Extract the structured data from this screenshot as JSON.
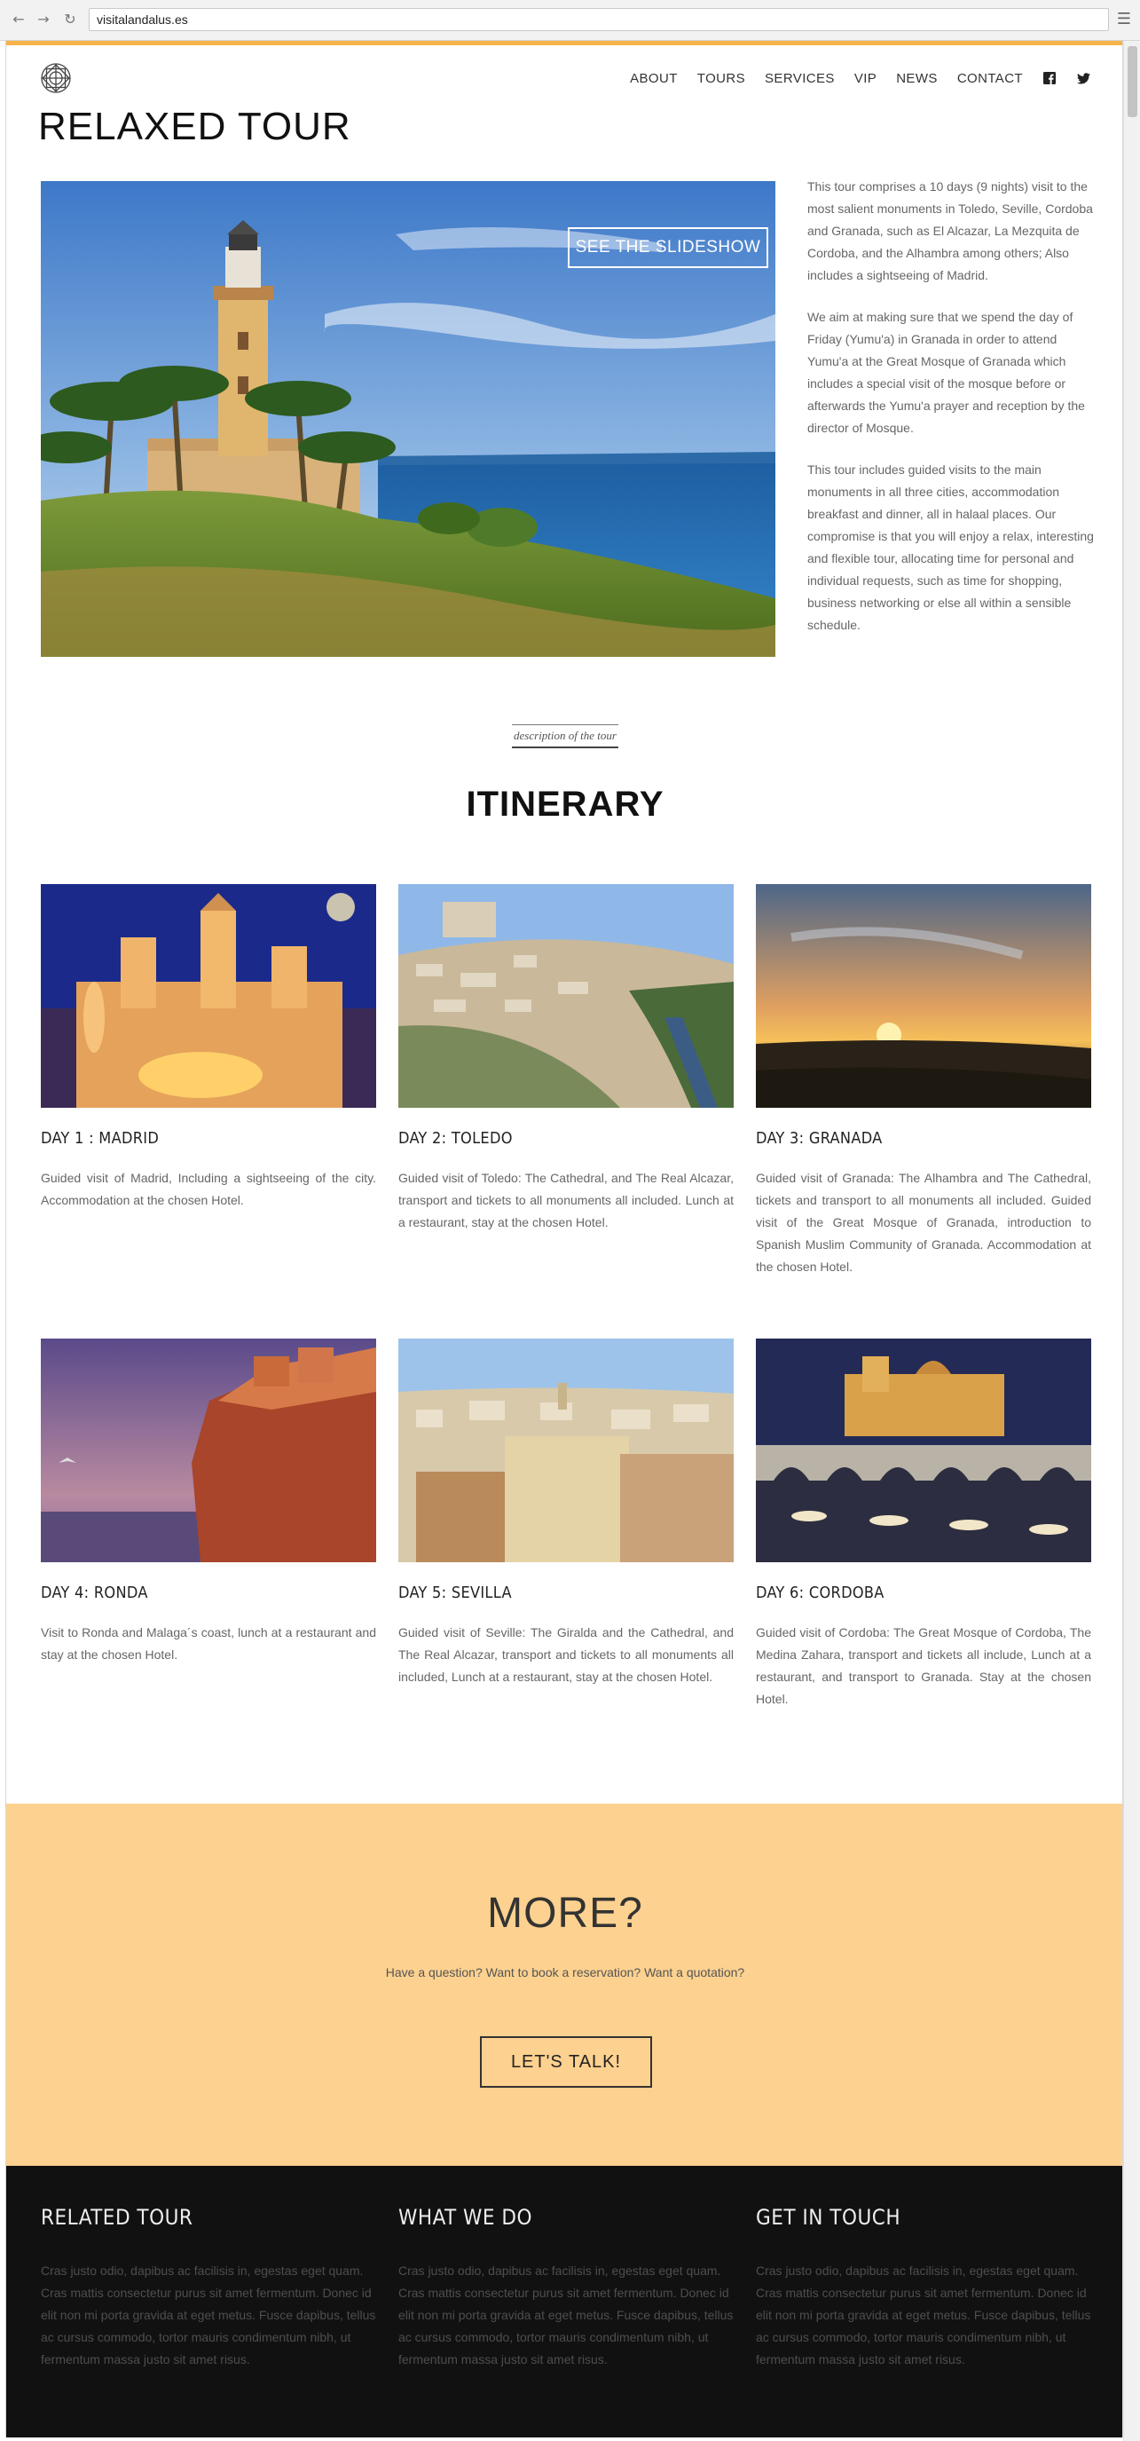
{
  "browser": {
    "url": "visitalandalus.es",
    "back_icon": "arrow-left-icon",
    "forward_icon": "arrow-right-icon",
    "reload_icon": "reload-icon",
    "menu_icon": "hamburger-menu-icon"
  },
  "colors": {
    "accent": "#f7b24a",
    "more_bg": "#fdd18f",
    "footer_bg": "#111111"
  },
  "header": {
    "logo_icon": "geometric-star-logo-icon",
    "nav": [
      "ABOUT",
      "TOURS",
      "SERVICES",
      "VIP",
      "NEWS",
      "CONTACT"
    ],
    "social_icons": [
      "facebook-icon",
      "twitter-icon"
    ]
  },
  "page": {
    "title": "RELAXED TOUR",
    "slideshow_label": "SEE THE SLIDESHOW",
    "intro": [
      "This tour comprises a 10 days (9 nights) visit to the most salient monuments in Toledo, Seville, Cordoba and Granada, such as El Alcazar, La Mezquita de Cordoba, and the Alhambra among others; Also includes a sightseeing of Madrid.",
      "We aim at making sure that we spend the day of Friday (Yumu'a) in Granada in order to attend Yumu'a at the Great Mosque of Granada which includes a special visit of the mosque before or afterwards the Yumu'a prayer and reception by the director of Mosque.",
      "This tour includes guided visits to the main monuments in all three cities, accommodation breakfast and dinner, all in halaal places. Our compromise is that you will enjoy a relax, interesting and flexible tour, allocating time for personal and individual requests, such as time for shopping, business networking or else all within a sensible schedule."
    ]
  },
  "itinerary": {
    "kicker": "description of the tour",
    "title": "ITINERARY",
    "days": [
      {
        "title": "DAY 1 : MADRID",
        "text": "Guided visit of Madrid, Including a sightseeing of the city. Accommodation at the chosen Hotel."
      },
      {
        "title": "DAY 2: TOLEDO",
        "text": "Guided visit of Toledo: The Cathedral, and The Real Alcazar, transport and tickets to all monuments all included. Lunch at a restaurant, stay at the chosen Hotel."
      },
      {
        "title": "DAY 3: GRANADA",
        "text": "Guided visit of Granada: The Alhambra and The Cathedral, tickets and transport to all monuments all included. Guided visit of the Great Mosque of Granada, introduction to Spanish Muslim Community of Granada. Accommodation at the chosen Hotel."
      },
      {
        "title": "DAY 4: RONDA",
        "text": "Visit to Ronda and Malaga´s coast, lunch at a restaurant and stay at the chosen Hotel."
      },
      {
        "title": "DAY 5: SEVILLA",
        "text": "Guided visit of Seville: The Giralda and the Cathedral, and The Real Alcazar, transport and tickets to all monuments all included, Lunch at a restaurant, stay at the chosen Hotel."
      },
      {
        "title": "DAY 6: CORDOBA",
        "text": "Guided visit of Cordoba: The Great Mosque of Cordoba, The Medina Zahara, transport and tickets all include, Lunch at a restaurant, and transport to Granada. Stay at the chosen Hotel."
      }
    ]
  },
  "more": {
    "title": "MORE?",
    "subtitle": "Have a question? Want to book a reservation? Want a quotation?",
    "button": "LET'S TALK!"
  },
  "footer": {
    "columns": [
      {
        "title": "RELATED TOUR",
        "text": "Cras justo odio, dapibus ac facilisis in, egestas eget quam. Cras mattis consectetur purus sit amet fermentum. Donec id elit non mi porta gravida at eget metus. Fusce dapibus, tellus ac cursus commodo, tortor mauris condimentum nibh, ut fermentum massa justo sit amet risus."
      },
      {
        "title": "WHAT WE DO",
        "text": "Cras justo odio, dapibus ac facilisis in, egestas eget quam. Cras mattis consectetur purus sit amet fermentum. Donec id elit non mi porta gravida at eget metus. Fusce dapibus, tellus ac cursus commodo, tortor mauris condimentum nibh, ut fermentum massa justo sit amet risus."
      },
      {
        "title": "GET IN TOUCH",
        "text": "Cras justo odio, dapibus ac facilisis in, egestas eget quam. Cras mattis consectetur purus sit amet fermentum. Donec id elit non mi porta gravida at eget metus. Fusce dapibus, tellus ac cursus commodo, tortor mauris condimentum nibh, ut fermentum massa justo sit amet risus."
      }
    ]
  }
}
